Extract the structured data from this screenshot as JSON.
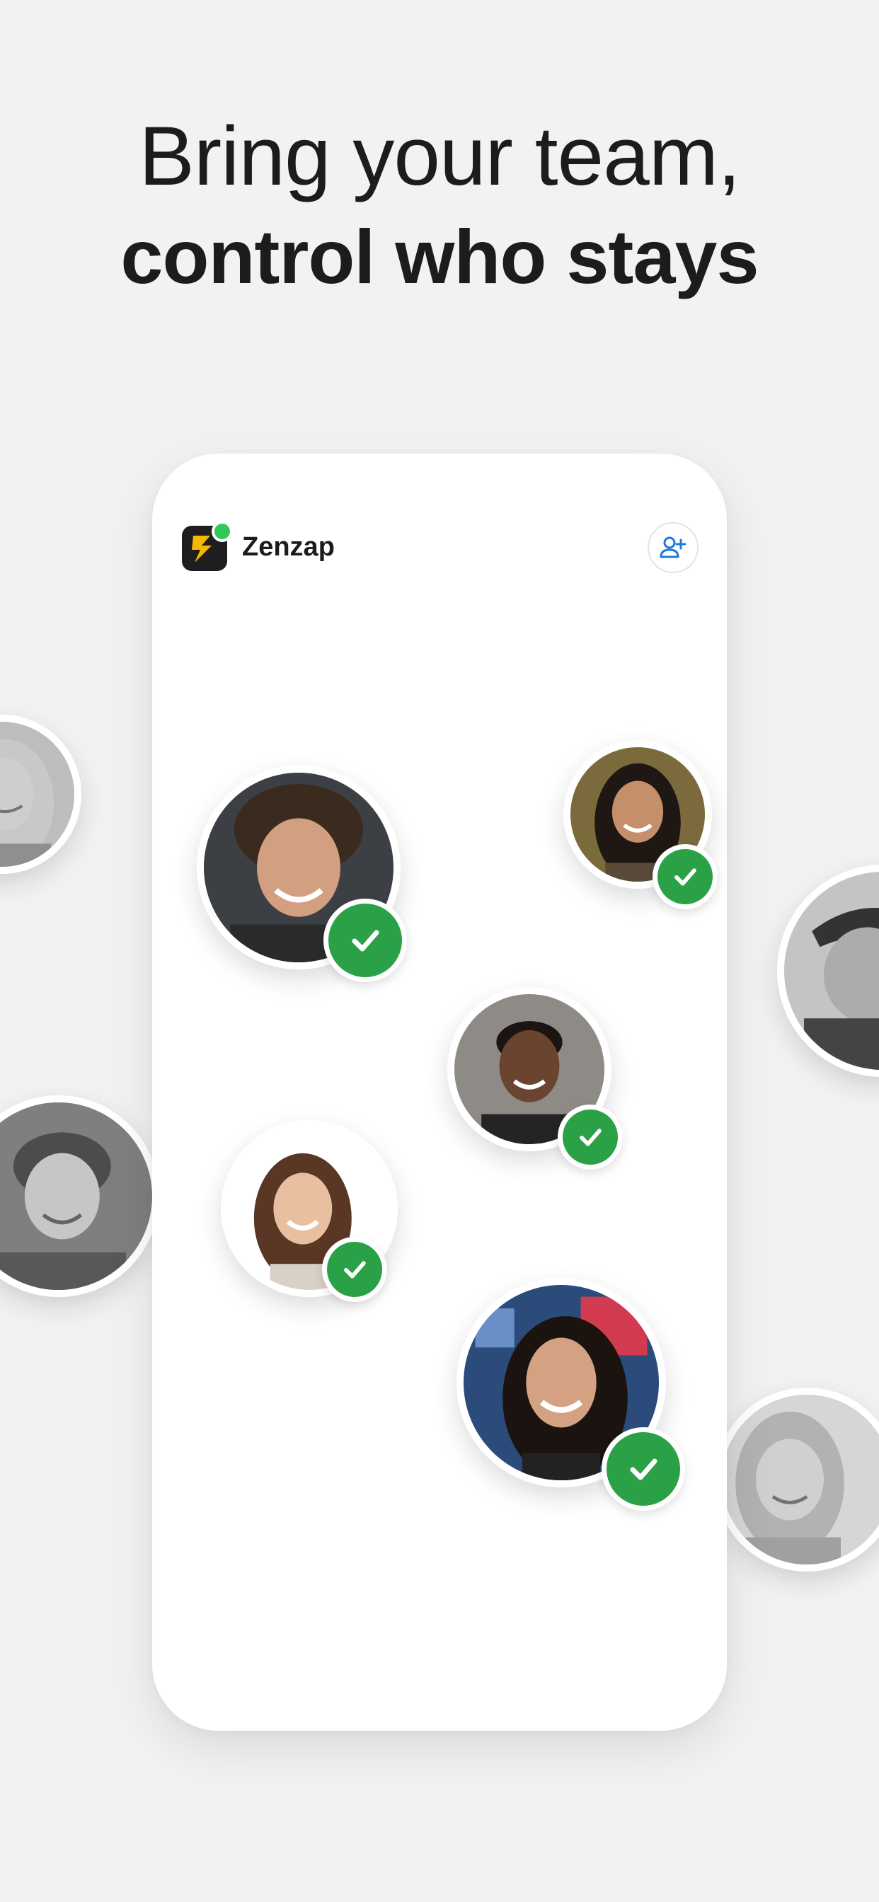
{
  "headline": {
    "line1": "Bring your team,",
    "line2": "control who stays"
  },
  "app": {
    "name": "Zenzap",
    "logo_icon": "lightning-bolt-icon",
    "status_icon": "online-dot-icon",
    "invite_icon": "add-user-icon"
  },
  "members": [
    {
      "name": "curly-haired-man",
      "approved": true
    },
    {
      "name": "woman-long-dark-hair",
      "approved": true
    },
    {
      "name": "smiling-young-man",
      "approved": true
    },
    {
      "name": "smiling-asian-woman",
      "approved": true
    },
    {
      "name": "woman-curly-hair",
      "approved": true
    }
  ],
  "outside_people": [
    {
      "name": "blonde-woman-left",
      "approved": false
    },
    {
      "name": "man-with-cap-right",
      "approved": false
    },
    {
      "name": "young-man-left",
      "approved": false
    },
    {
      "name": "blonde-woman-right",
      "approved": false
    }
  ],
  "colors": {
    "background": "#f2f2f4",
    "accent_green": "#2aa147",
    "online_green": "#32c759",
    "invite_blue": "#1f7ae0",
    "logo_yellow": "#f5b800"
  }
}
